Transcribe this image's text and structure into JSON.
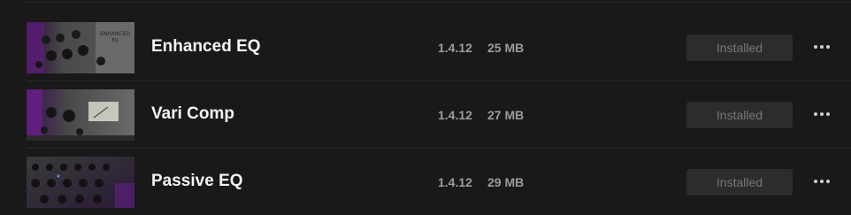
{
  "plugins": [
    {
      "name": "Enhanced EQ",
      "version": "1.4.12",
      "size": "25 MB",
      "status": "Installed",
      "thumb_icon": "enhanced-eq-hardware-image"
    },
    {
      "name": "Vari Comp",
      "version": "1.4.12",
      "size": "27 MB",
      "status": "Installed",
      "thumb_icon": "vari-comp-hardware-image"
    },
    {
      "name": "Passive EQ",
      "version": "1.4.12",
      "size": "29 MB",
      "status": "Installed",
      "thumb_icon": "passive-eq-hardware-image"
    }
  ],
  "colors": {
    "background": "#191919",
    "divider": "#2a2a2a",
    "button_bg": "#2c2c2c",
    "button_text": "#777777",
    "meta_text": "#9c9c9c",
    "accent_purple": "#6a2a8a"
  }
}
